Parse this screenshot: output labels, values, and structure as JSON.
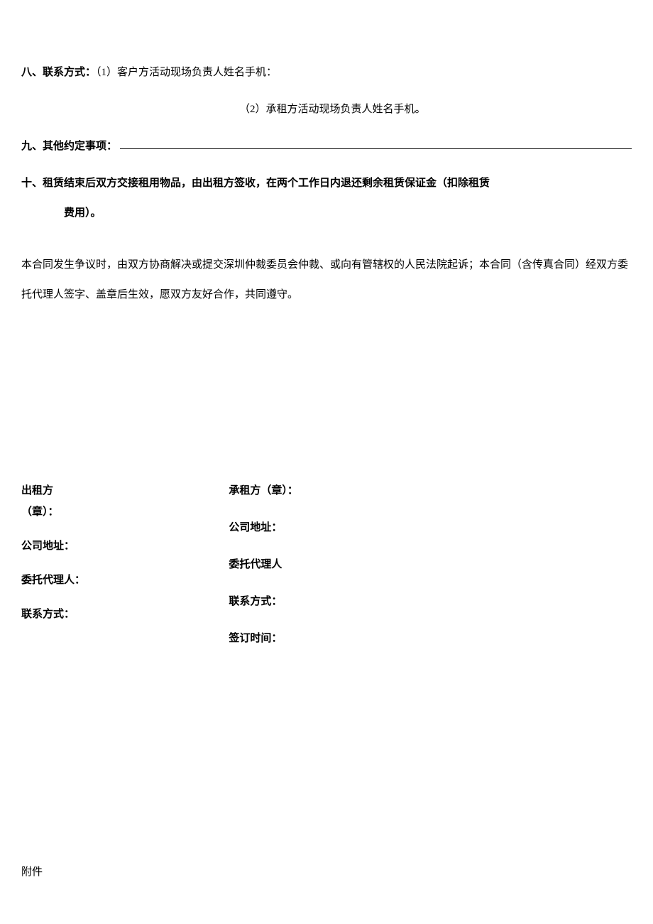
{
  "clauses": {
    "eight": {
      "label": "八、联系方式：",
      "item1_prefix": "（1）",
      "item1_text": "客户方活动现场负责人姓名手机：",
      "item2_prefix": "（2）",
      "item2_text": "承租方活动现场负责人姓名手机。"
    },
    "nine": {
      "label": "九、其他约定事项：",
      "blank_value": ""
    },
    "ten": {
      "label": "十、",
      "line1": "租赁结束后双方交接租用物品，由出租方签收，在两个工作日内退还剩余租赁保证金（扣除租赁",
      "line2": "费用）。"
    }
  },
  "dispute_paragraph": "本合同发生争议时，由双方协商解决或提交深圳仲裁委员会仲裁、或向有管辖权的人民法院起诉；本合同（含传真合同）经双方委托代理人签字、盖章后生效，愿双方友好合作，共同遵守。",
  "signatures": {
    "left": {
      "party_label_1": "出租方",
      "party_label_2": "（章）：",
      "address_label": "公司地址：",
      "agent_label": "委托代理人：",
      "contact_label": "联系方式："
    },
    "right": {
      "party_label": "承租方（章）：",
      "address_label": "公司地址：",
      "agent_label": "委托代理人",
      "contact_label": "联系方式：",
      "date_label": "签订时间："
    }
  },
  "attachment_label": "附件"
}
